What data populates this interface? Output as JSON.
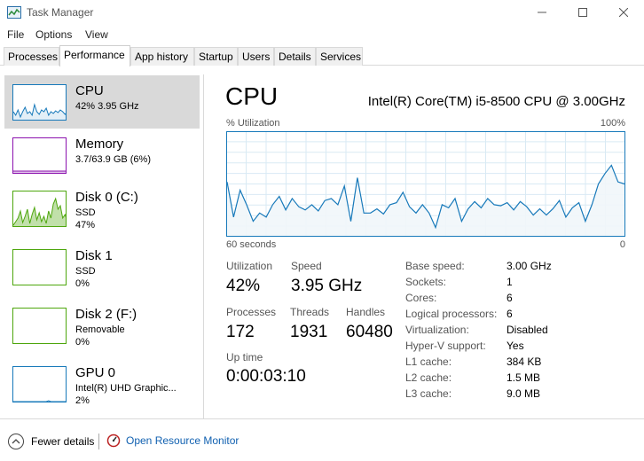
{
  "window": {
    "title": "Task Manager"
  },
  "menu": [
    "File",
    "Options",
    "View"
  ],
  "tabs": [
    {
      "label": "Processes"
    },
    {
      "label": "Performance"
    },
    {
      "label": "App history"
    },
    {
      "label": "Startup"
    },
    {
      "label": "Users"
    },
    {
      "label": "Details"
    },
    {
      "label": "Services"
    }
  ],
  "active_tab": "Performance",
  "sidebar": {
    "items": [
      {
        "name": "CPU",
        "lines": [
          "42%  3.95 GHz"
        ],
        "color": "#1779ba"
      },
      {
        "name": "Memory",
        "lines": [
          "3.7/63.9 GB (6%)"
        ],
        "color": "#8b12ae"
      },
      {
        "name": "Disk 0 (C:)",
        "lines": [
          "SSD",
          "47%"
        ],
        "color": "#4da60c"
      },
      {
        "name": "Disk 1",
        "lines": [
          "SSD",
          "0%"
        ],
        "color": "#4da60c"
      },
      {
        "name": "Disk 2 (F:)",
        "lines": [
          "Removable",
          "0%"
        ],
        "color": "#4da60c"
      },
      {
        "name": "GPU 0",
        "lines": [
          "Intel(R) UHD Graphic...",
          "2%"
        ],
        "color": "#1779ba"
      }
    ]
  },
  "main": {
    "title": "CPU",
    "model": "Intel(R) Core(TM) i5-8500 CPU @ 3.00GHz",
    "graph": {
      "y_label": "% Utilization",
      "y_max_label": "100%",
      "x_left_label": "60 seconds",
      "x_right_label": "0",
      "line_color": "#1779ba",
      "fill_color": "#f1f6fa",
      "grid_color": "#d9eaf4",
      "values": [
        52,
        18,
        44,
        30,
        14,
        22,
        18,
        30,
        38,
        25,
        36,
        28,
        25,
        30,
        24,
        34,
        36,
        30,
        48,
        14,
        56,
        22,
        22,
        26,
        21,
        30,
        32,
        42,
        28,
        22,
        30,
        22,
        8,
        30,
        27,
        36,
        14,
        26,
        33,
        27,
        36,
        30,
        29,
        32,
        25,
        33,
        28,
        20,
        26,
        20,
        26,
        34,
        18,
        27,
        32,
        14,
        30,
        50,
        60,
        68,
        52,
        50
      ]
    },
    "stats": {
      "utilization": {
        "label": "Utilization",
        "value": "42%"
      },
      "speed": {
        "label": "Speed",
        "value": "3.95 GHz"
      },
      "processes": {
        "label": "Processes",
        "value": "172"
      },
      "threads": {
        "label": "Threads",
        "value": "1931"
      },
      "handles": {
        "label": "Handles",
        "value": "60480"
      },
      "uptime": {
        "label": "Up time",
        "value": "0:00:03:10"
      }
    },
    "specs": [
      {
        "key": "Base speed:",
        "value": "3.00 GHz"
      },
      {
        "key": "Sockets:",
        "value": "1"
      },
      {
        "key": "Cores:",
        "value": "6"
      },
      {
        "key": "Logical processors:",
        "value": "6"
      },
      {
        "key": "Virtualization:",
        "value": "Disabled"
      },
      {
        "key": "Hyper-V support:",
        "value": "Yes"
      },
      {
        "key": "L1 cache:",
        "value": "384 KB"
      },
      {
        "key": "L2 cache:",
        "value": "1.5 MB"
      },
      {
        "key": "L3 cache:",
        "value": "9.0 MB"
      }
    ]
  },
  "footer": {
    "fewer_details": "Fewer details",
    "open_resource_monitor": "Open Resource Monitor"
  }
}
